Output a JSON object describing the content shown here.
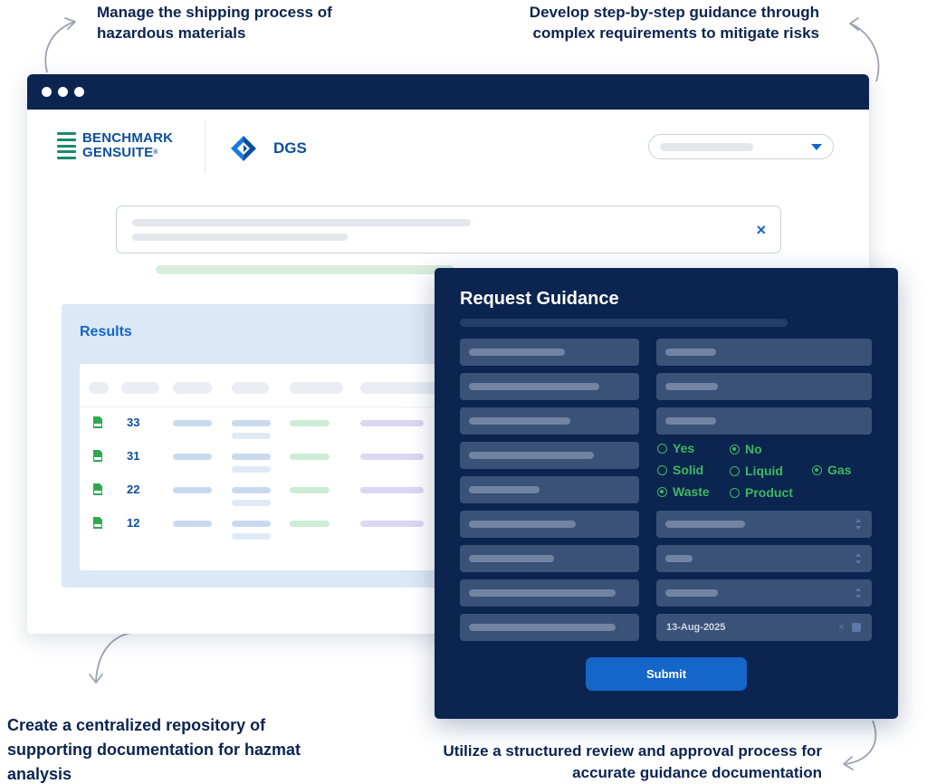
{
  "captions": {
    "top_left": "Manage the shipping process of hazardous materials",
    "top_right": "Develop step-by-step guidance through complex requirements to mitigate risks",
    "bottom_left": "Create a centralized repository of supporting documentation for hazmat analysis",
    "bottom_right": "Utilize a structured review and approval process for accurate guidance documentation"
  },
  "header": {
    "brand_line1": "BENCHMARK",
    "brand_line2": "GENSUITE",
    "brand_mark": "®",
    "app_name": "DGS"
  },
  "search": {
    "clear_icon": "×"
  },
  "results": {
    "title": "Results",
    "rows": [
      {
        "count": "33"
      },
      {
        "count": "31"
      },
      {
        "count": "22"
      },
      {
        "count": "12"
      }
    ]
  },
  "request_guidance": {
    "title": "Request Guidance",
    "radios": {
      "yes": "Yes",
      "no": "No",
      "solid": "Solid",
      "liquid": "Liquid",
      "gas": "Gas",
      "waste": "Waste",
      "product": "Product"
    },
    "selected": [
      "No",
      "Gas",
      "Waste"
    ],
    "date_value": "13-Aug-2025",
    "submit_label": "Submit"
  },
  "colors": {
    "navy": "#0b2450",
    "brand_blue": "#1466c8",
    "radio_green": "#3fb860"
  }
}
